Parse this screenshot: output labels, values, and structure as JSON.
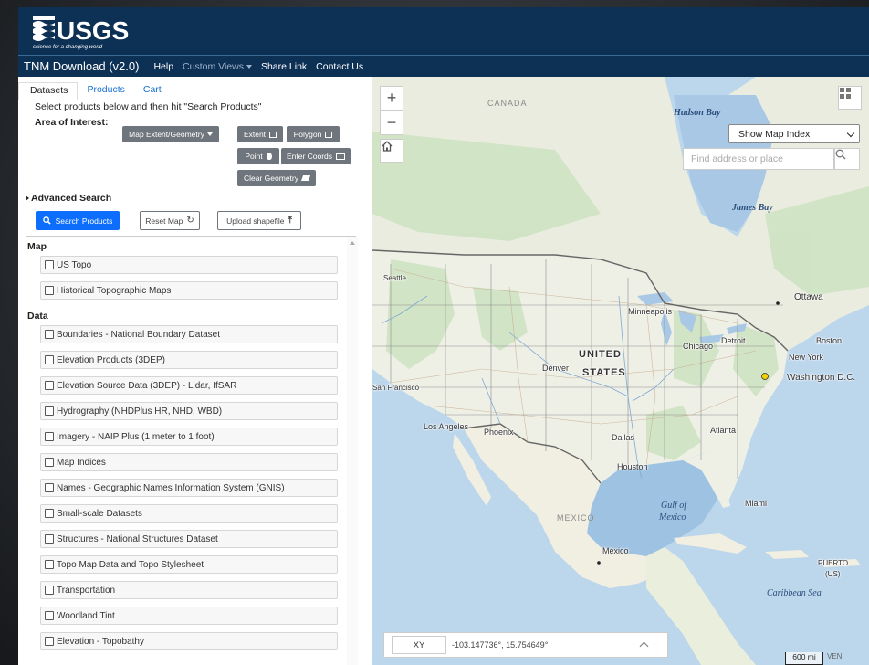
{
  "brand": {
    "logo_text": "USGS",
    "tagline": "science for a changing world"
  },
  "nav": {
    "title": "TNM Download (v2.0)",
    "links": [
      {
        "label": "Help"
      },
      {
        "label": "Custom Views"
      },
      {
        "label": "Share Link"
      },
      {
        "label": "Contact Us"
      }
    ]
  },
  "tabs": [
    "Datasets",
    "Products",
    "Cart"
  ],
  "instructions": "Select products below and then hit \"Search Products\"",
  "aoi": {
    "label": "Area of Interest:",
    "dropdown": "Map Extent/Geometry",
    "buttons": {
      "extent": "Extent",
      "polygon": "Polygon",
      "point": "Point",
      "coords": "Enter Coords",
      "clear": "Clear Geometry"
    }
  },
  "advanced": "Advanced Search",
  "actions": {
    "search": "Search Products",
    "reset": "Reset Map",
    "upload": "Upload shapefile"
  },
  "sections": {
    "map": {
      "title": "Map",
      "items": [
        "US Topo",
        "Historical Topographic Maps"
      ]
    },
    "data": {
      "title": "Data",
      "items": [
        "Boundaries - National Boundary Dataset",
        "Elevation Products (3DEP)",
        "Elevation Source Data (3DEP) - Lidar, IfSAR",
        "Hydrography (NHDPlus HR, NHD, WBD)",
        "Imagery - NAIP Plus (1 meter to 1 foot)",
        "Map Indices",
        "Names - Geographic Names Information System (GNIS)",
        "Small-scale Datasets",
        "Structures - National Structures Dataset",
        "Topo Map Data and Topo Stylesheet",
        "Transportation",
        "Woodland Tint",
        "Elevation - Topobathy"
      ]
    }
  },
  "map": {
    "index_select": "Show Map Index",
    "search_placeholder": "Find address or place",
    "coord_mode": "XY",
    "coord_value": "-103.147736°, 15.754649°",
    "scale": "600 mi",
    "scale_extra": "VEN",
    "labels": {
      "canada": "CANADA",
      "hudson_bay": "Hudson Bay",
      "james_bay": "James Bay",
      "united": "UNITED",
      "states": "STATES",
      "mexico": "MEXICO",
      "gulf1": "Gulf of",
      "gulf2": "Mexico",
      "caribbean": "Caribbean Sea",
      "seattle": "Seattle",
      "minneapolis": "Minneapolis",
      "ottawa": "Ottawa",
      "chicago": "Chicago",
      "detroit": "Detroit",
      "boston": "Boston",
      "newyork": "New York",
      "washington": "Washington D.C.",
      "denver": "Denver",
      "sanfrancisco": "San Francisco",
      "losangeles": "Los Angeles",
      "phoenix": "Phoenix",
      "dallas": "Dallas",
      "atlanta": "Atlanta",
      "houston": "Houston",
      "miami": "Miami",
      "mexicocity": "México",
      "puerto": "PUERTO",
      "us": "(US)"
    }
  },
  "colors": {
    "header": "#0d3055",
    "primary": "#0d6efd",
    "secondary": "#6e757c"
  }
}
